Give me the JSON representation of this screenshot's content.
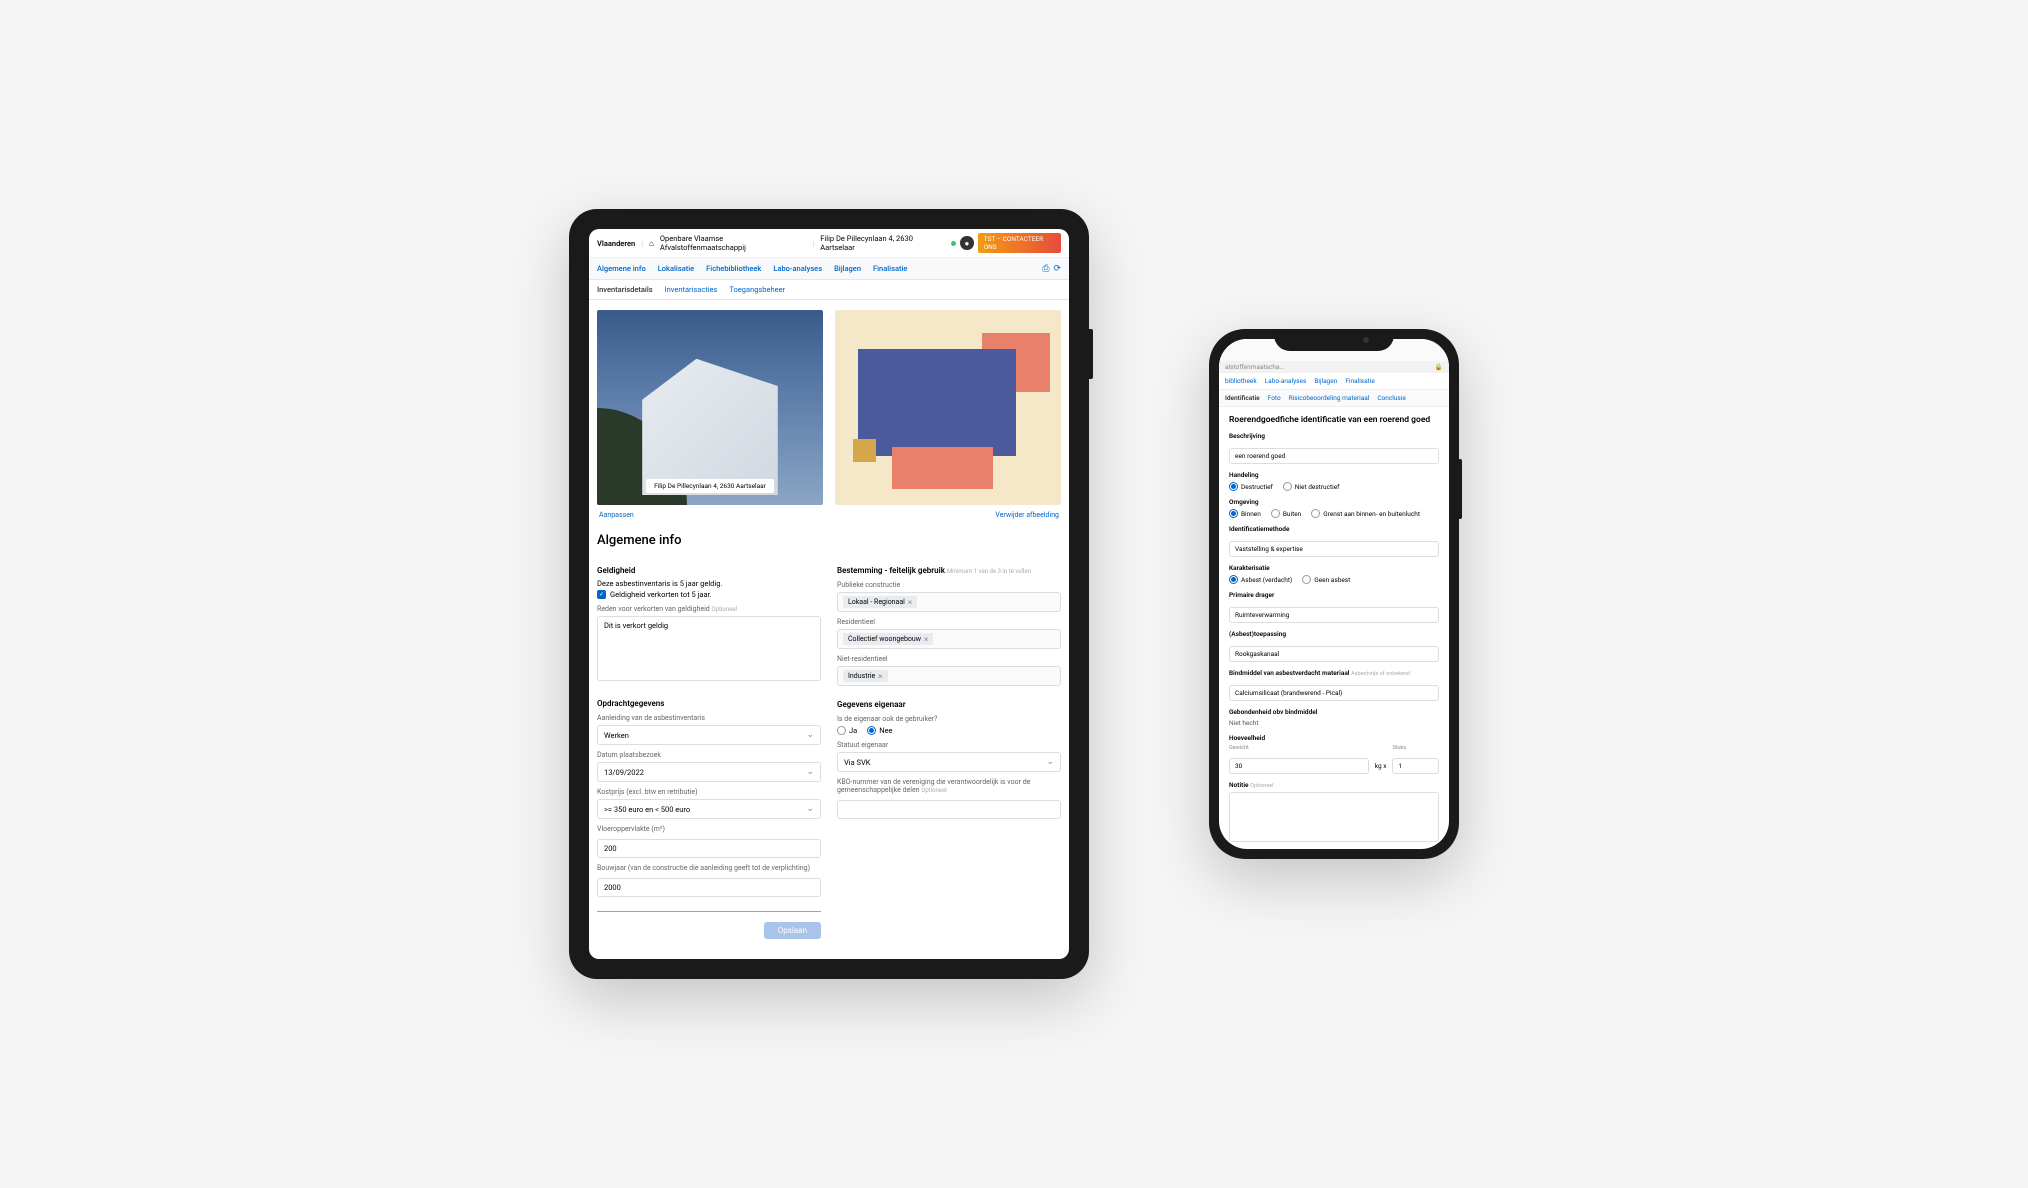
{
  "tablet": {
    "breadcrumb": {
      "brand": "Vlaanderen",
      "org": "Openbare Vlaamse Afvalstoffenmaatschappij",
      "address": "Filip De Pillecynlaan 4, 2630 Aartselaar"
    },
    "contact_btn": "TST – CONTACTEER ONS",
    "tabs": [
      "Algemene info",
      "Lokalisatie",
      "Fichebibliotheek",
      "Labo-analyses",
      "Bijlagen",
      "Finalisatie"
    ],
    "subtabs": [
      "Inventarisdetails",
      "Inventarisacties",
      "Toegangsbeheer"
    ],
    "photo_address": "Filip De Pillecynlaan 4, 2630 Aartselaar",
    "img_actions": {
      "edit": "Aanpassen",
      "remove": "Verwijder afbeelding"
    },
    "section_title": "Algemene info",
    "geldigheid": {
      "heading": "Geldigheid",
      "line1": "Deze asbestinventaris is 5 jaar geldig.",
      "checkbox": "Geldigheid verkorten tot 5 jaar.",
      "reason_label": "Reden voor verkorten van geldigheid",
      "reason_opt": "Optioneel",
      "reason_value": "Dit is verkort geldig"
    },
    "opdracht": {
      "heading": "Opdrachtgegevens",
      "aanleiding_label": "Aanleiding van de asbestinventaris",
      "aanleiding_value": "Werken",
      "datum_label": "Datum plaatsbezoek",
      "datum_value": "13/09/2022",
      "kostprijs_label": "Kostprijs (excl. btw en retributie)",
      "kostprijs_value": ">= 350 euro en < 500 euro",
      "vloer_label": "Vloeroppervlakte (m²)",
      "vloer_value": "200",
      "bouwjaar_label": "Bouwjaar (van de constructie die aanleiding geeft tot de verplichting)",
      "bouwjaar_value": "2000"
    },
    "bestemming": {
      "heading": "Bestemming - feitelijk gebruik",
      "hint": "Minimum 1 van de 3 in te vullen",
      "publieke_label": "Publieke constructie",
      "publieke_tag": "Lokaal - Regionaal",
      "resident_label": "Residentieel",
      "resident_tag": "Collectief woongebouw",
      "nietres_label": "Niet-residentieel",
      "nietres_tag": "Industrie"
    },
    "eigenaar": {
      "heading": "Gegevens eigenaar",
      "q_label": "Is de eigenaar ook de gebruiker?",
      "ja": "Ja",
      "nee": "Nee",
      "statuut_label": "Statuut eigenaar",
      "statuut_value": "Via SVK",
      "kbo_label": "KBO-nummer van de vereniging die verantwoordelijk is voor de gemeenschappelijke delen",
      "kbo_opt": "Optioneel"
    },
    "save": "Opslaan"
  },
  "phone": {
    "crumb_left": "alstoffenmaatscha...",
    "tabs": [
      "bibliotheek",
      "Labo-analyses",
      "Bijlagen",
      "Finalisatie"
    ],
    "subtabs": [
      "Identificatie",
      "Foto",
      "Risicobeoordeling materiaal",
      "Conclusie"
    ],
    "title": "Roerendgoedfiche identificatie van een roerend goed",
    "beschrijving_label": "Beschrijving",
    "beschrijving_value": "een roerend goed",
    "handeling_label": "Handeling",
    "handeling_opts": [
      "Destructief",
      "Niet destructief"
    ],
    "omgeving_label": "Omgeving",
    "omgeving_opts": [
      "Binnen",
      "Buiten",
      "Grenst aan binnen- en buitenlucht"
    ],
    "ident_label": "Identificatiemethode",
    "ident_value": "Vaststelling & expertise",
    "karakter_label": "Karakterisatie",
    "karakter_opts": [
      "Asbest (verdacht)",
      "Geen asbest"
    ],
    "drager_label": "Primaire drager",
    "drager_value": "Ruimteverwarming",
    "toepassing_label": "(Asbest)toepassing",
    "toepassing_value": "Rookgaskanaal",
    "bindmiddel_label": "Bindmiddel van asbestverdacht materiaal",
    "bindmiddel_opt": "Asbestvrije of onbekend",
    "bindmiddel_value": "Calciumsilicaat (brandwerend - Pical)",
    "gebonden_label": "Gebondenheid obv bindmiddel",
    "gebonden_value": "Niet hecht",
    "hoeveel_label": "Hoeveelheid",
    "gewicht_label": "Gewicht",
    "gewicht_value": "30",
    "kg": "kg  x",
    "stuks_label": "Stuks",
    "stuks_value": "1",
    "notitie_label": "Notitie",
    "notitie_opt": "Optioneel"
  }
}
